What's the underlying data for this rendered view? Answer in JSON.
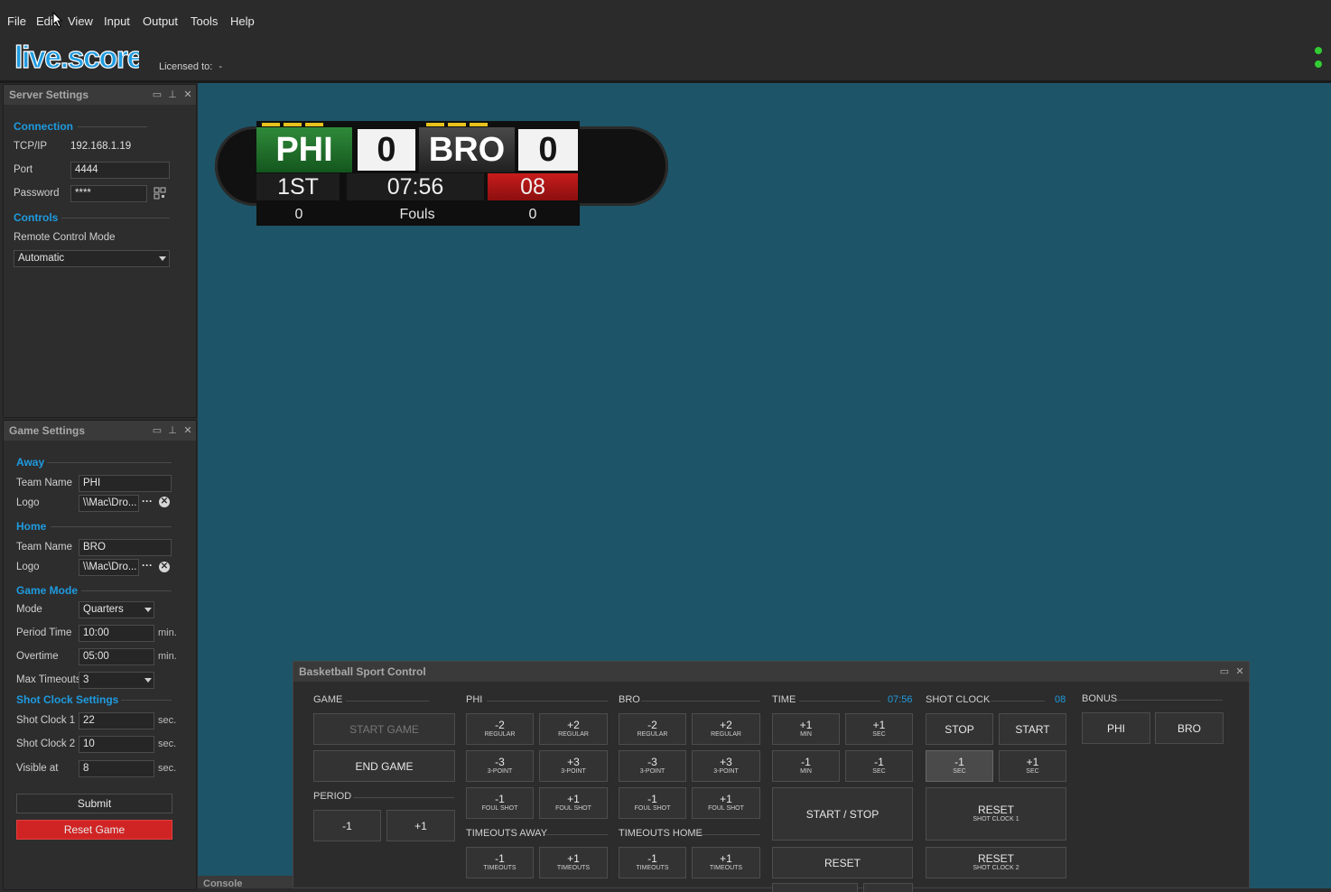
{
  "menu": {
    "items": [
      "File",
      "Edit",
      "View",
      "Input",
      "Output",
      "Tools",
      "Help"
    ]
  },
  "header": {
    "logo_text": "live.score",
    "licensed_label": "Licensed to:",
    "licensed_value": "-"
  },
  "server_settings": {
    "title": "Server Settings",
    "connection": {
      "heading": "Connection",
      "tcp_label": "TCP/IP",
      "tcp_value": "192.168.1.19",
      "port_label": "Port",
      "port_value": "4444",
      "password_label": "Password",
      "password_value": "****"
    },
    "controls": {
      "heading": "Controls",
      "remote_mode_label": "Remote Control Mode",
      "remote_mode_value": "Automatic"
    }
  },
  "game_settings": {
    "title": "Game Settings",
    "away": {
      "heading": "Away",
      "team_name_label": "Team Name",
      "team_name_value": "PHI",
      "logo_label": "Logo",
      "logo_value": "\\\\Mac\\Dro..."
    },
    "home": {
      "heading": "Home",
      "team_name_label": "Team Name",
      "team_name_value": "BRO",
      "logo_label": "Logo",
      "logo_value": "\\\\Mac\\Dro..."
    },
    "game_mode": {
      "heading": "Game Mode",
      "mode_label": "Mode",
      "mode_value": "Quarters",
      "period_time_label": "Period Time",
      "period_time_value": "10:00",
      "period_time_unit": "min.",
      "overtime_label": "Overtime",
      "overtime_value": "05:00",
      "overtime_unit": "min.",
      "max_timeouts_label": "Max Timeouts",
      "max_timeouts_value": "3"
    },
    "shot_clock": {
      "heading": "Shot Clock Settings",
      "sc1_label": "Shot Clock 1",
      "sc1_value": "22",
      "sc1_unit": "sec.",
      "sc2_label": "Shot Clock 2",
      "sc2_value": "10",
      "sc2_unit": "sec.",
      "visible_label": "Visible at",
      "visible_value": "8",
      "visible_unit": "sec."
    },
    "submit_label": "Submit",
    "reset_label": "Reset Game"
  },
  "scoreboard": {
    "away_team": "PHI",
    "away_score": "0",
    "home_team": "BRO",
    "home_score": "0",
    "period": "1ST",
    "clock": "07:56",
    "shot_clock": "08",
    "away_fouls": "0",
    "fouls_label": "Fouls",
    "home_fouls": "0",
    "away_timeouts": 3,
    "home_timeouts": 3
  },
  "control": {
    "title": "Basketball Sport Control",
    "game": {
      "heading": "GAME",
      "start_label": "START GAME",
      "end_label": "END GAME"
    },
    "period": {
      "heading": "PERIOD",
      "minus": "-1",
      "plus": "+1"
    },
    "phi": {
      "heading": "PHI",
      "m2": "-2",
      "m2_sub": "REGULAR",
      "p2": "+2",
      "p2_sub": "REGULAR",
      "m3": "-3",
      "m3_sub": "3-POINT",
      "p3": "+3",
      "p3_sub": "3-POINT",
      "m1": "-1",
      "m1_sub": "FOUL SHOT",
      "p1": "+1",
      "p1_sub": "FOUL SHOT"
    },
    "bro": {
      "heading": "BRO",
      "m2": "-2",
      "m2_sub": "REGULAR",
      "p2": "+2",
      "p2_sub": "REGULAR",
      "m3": "-3",
      "m3_sub": "3-POINT",
      "p3": "+3",
      "p3_sub": "3-POINT",
      "m1": "-1",
      "m1_sub": "FOUL SHOT",
      "p1": "+1",
      "p1_sub": "FOUL SHOT"
    },
    "timeouts_away": {
      "heading": "TIMEOUTS AWAY",
      "minus": "-1",
      "minus_sub": "TIMEOUTS",
      "plus": "+1",
      "plus_sub": "TIMEOUTS"
    },
    "timeouts_home": {
      "heading": "TIMEOUTS HOME",
      "minus": "-1",
      "minus_sub": "TIMEOUTS",
      "plus": "+1",
      "plus_sub": "TIMEOUTS"
    },
    "time": {
      "heading": "TIME",
      "value": "07:56",
      "p1min": "+1",
      "p1min_sub": "MIN",
      "p1sec": "+1",
      "p1sec_sub": "SEC",
      "m1min": "-1",
      "m1min_sub": "MIN",
      "m1sec": "-1",
      "m1sec_sub": "SEC",
      "start_stop": "START / STOP",
      "reset": "RESET"
    },
    "shot_clock": {
      "heading": "SHOT CLOCK",
      "value": "08",
      "stop": "STOP",
      "start": "START",
      "m1": "-1",
      "m1_sub": "SEC",
      "p1": "+1",
      "p1_sub": "SEC",
      "reset1": "RESET",
      "reset1_sub": "SHOT CLOCK 1",
      "reset2": "RESET",
      "reset2_sub": "SHOT CLOCK 2"
    },
    "bonus": {
      "heading": "BONUS",
      "phi": "PHI",
      "bro": "BRO"
    }
  },
  "console": {
    "title": "Console"
  },
  "colors": {
    "accent": "#1e9be0",
    "preview_bg": "#1e5467",
    "reset_red": "#d02424",
    "led_green": "#33cc33"
  }
}
